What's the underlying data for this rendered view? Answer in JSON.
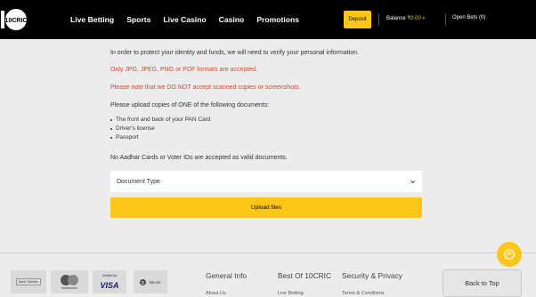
{
  "header": {
    "logo_text": "10CRIC",
    "nav": [
      "Live Betting",
      "Sports",
      "Live Casino",
      "Casino",
      "Promotions"
    ],
    "deposit_label": "Deposit",
    "balance_label": "Balance",
    "balance_amount": "₹0.00",
    "open_bets_label": "Open Bets (0)"
  },
  "verification": {
    "intro": "In order to protect your identity and funds, we will need to verify your personal information.",
    "formats_note": "Only JPG, JPEG, PNG or PDF formats are accepted.",
    "scan_note": "Please note that we DO NOT accept scanned copies or screenshots.",
    "upload_instruction": "Please upload copies of ONE of the following documents:",
    "documents": [
      "The front and back of your PAN Card",
      "Driver's license",
      "Passport"
    ],
    "not_accepted": "No Aadhar Cards or Voter IDs are accepted as valid documents.",
    "document_type_value": "Document Type",
    "upload_label": "Upload files"
  },
  "footer": {
    "payment_badges": [
      "Bank Transfer",
      "mastercard",
      "Verified by",
      "VISA",
      "bitcoin"
    ],
    "columns": [
      {
        "title": "General Info",
        "first_link": "About Us"
      },
      {
        "title": "Best Of 10CRIC",
        "first_link": "Live Betting"
      },
      {
        "title": "Security & Privacy",
        "first_link": "Terms & Conditions"
      }
    ],
    "back_to_top_label": "Back to Top"
  },
  "colors": {
    "accent": "#ffc61a",
    "header_bg": "#000000",
    "warning": "#d9452b",
    "page_bg": "#ececec"
  },
  "icons": [
    "logo-icon",
    "chevron-down-icon",
    "chat-icon",
    "mastercard-icon",
    "bitcoin-icon"
  ]
}
